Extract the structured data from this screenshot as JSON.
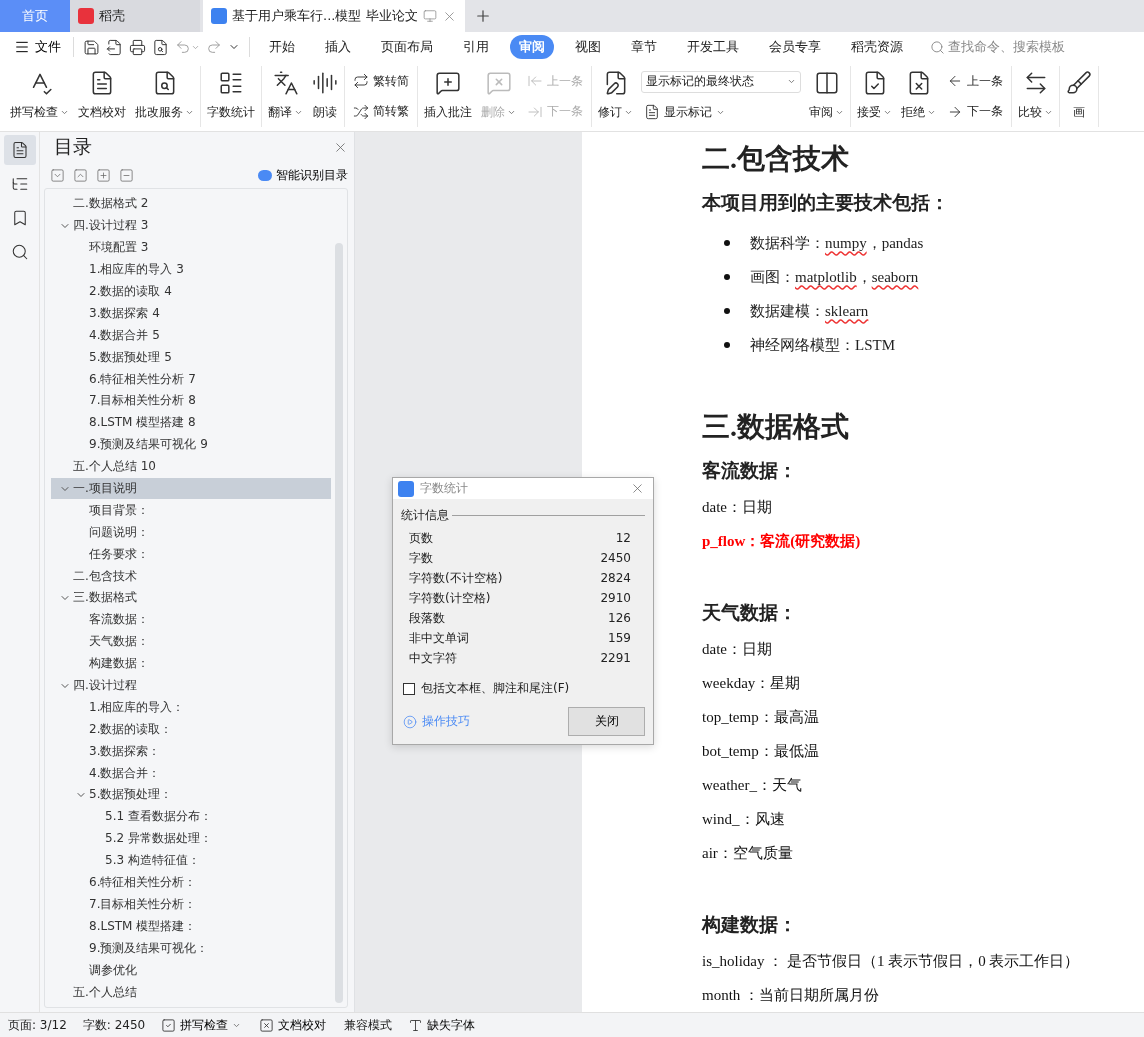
{
  "tabs": [
    {
      "label": "首页",
      "kind": "home",
      "selected": false
    },
    {
      "label": "稻壳",
      "kind": "app",
      "selected": false
    },
    {
      "label": "基于用户乘车行...模型 毕业论文",
      "kind": "document",
      "selected": true
    }
  ],
  "menu": {
    "file": "文件",
    "tabs": [
      {
        "label": "开始",
        "selected": false
      },
      {
        "label": "插入",
        "selected": false
      },
      {
        "label": "页面布局",
        "selected": false
      },
      {
        "label": "引用",
        "selected": false
      },
      {
        "label": "审阅",
        "selected": true
      },
      {
        "label": "视图",
        "selected": false
      },
      {
        "label": "章节",
        "selected": false
      },
      {
        "label": "开发工具",
        "selected": false
      },
      {
        "label": "会员专享",
        "selected": false
      },
      {
        "label": "稻壳资源",
        "selected": false
      }
    ],
    "search_placeholder": "查找命令、搜索模板"
  },
  "ribbon": {
    "groups": [
      {
        "items": [
          {
            "kind": "large",
            "label": "拼写检查",
            "menu": true,
            "disabled": false
          },
          {
            "kind": "large",
            "label": "文档校对",
            "menu": false,
            "disabled": false
          },
          {
            "kind": "large",
            "label": "批改服务",
            "menu": true,
            "disabled": false
          }
        ]
      },
      {
        "items": [
          {
            "kind": "large",
            "label": "字数统计",
            "menu": false,
            "disabled": false
          }
        ]
      },
      {
        "items": [
          {
            "kind": "large",
            "label": "翻译",
            "menu": true,
            "disabled": false
          },
          {
            "kind": "large",
            "label": "朗读",
            "menu": false,
            "disabled": false
          }
        ]
      },
      {
        "items": [
          {
            "kind": "stack",
            "items": [
              {
                "kind": "small",
                "label": "繁转简",
                "menu": false,
                "disabled": false
              },
              {
                "kind": "small",
                "label": "简转繁",
                "menu": false,
                "disabled": false
              }
            ]
          }
        ]
      },
      {
        "items": [
          {
            "kind": "large",
            "label": "插入批注",
            "menu": false,
            "disabled": false
          },
          {
            "kind": "large",
            "label": "删除",
            "menu": true,
            "disabled": true
          },
          {
            "kind": "stack",
            "items": [
              {
                "kind": "small",
                "label": "上一条",
                "menu": false,
                "disabled": true
              },
              {
                "kind": "small",
                "label": "下一条",
                "menu": false,
                "disabled": true
              }
            ]
          }
        ]
      },
      {
        "items": [
          {
            "kind": "large",
            "label": "修订",
            "menu": true,
            "disabled": false
          },
          {
            "kind": "stack",
            "items": [
              {
                "kind": "select",
                "value": "显示标记的最终状态"
              },
              {
                "kind": "small",
                "label": "显示标记",
                "menu": true,
                "disabled": false
              }
            ]
          },
          {
            "kind": "large",
            "label": "审阅",
            "menu": true,
            "disabled": false
          }
        ]
      },
      {
        "items": [
          {
            "kind": "large",
            "label": "接受",
            "menu": true,
            "disabled": false
          },
          {
            "kind": "large",
            "label": "拒绝",
            "menu": true,
            "disabled": false
          },
          {
            "kind": "stack",
            "items": [
              {
                "kind": "small",
                "label": "上一条",
                "menu": false,
                "disabled": false
              },
              {
                "kind": "small",
                "label": "下一条",
                "menu": false,
                "disabled": false
              }
            ]
          }
        ]
      },
      {
        "items": [
          {
            "kind": "large",
            "label": "比较",
            "menu": true,
            "disabled": false
          }
        ]
      },
      {
        "items": [
          {
            "kind": "large",
            "label": "画",
            "menu": false,
            "disabled": false
          }
        ]
      }
    ]
  },
  "rail": [
    {
      "selected": true
    },
    {
      "selected": false
    },
    {
      "selected": false
    },
    {
      "selected": false
    }
  ],
  "toc": {
    "title": "目录",
    "smart_button": "智能识别目录",
    "items": [
      {
        "label": "二.数据格式 2",
        "selected": false
      },
      {
        "label": "四.设计过程 3",
        "selected": false,
        "expanded": true,
        "children": [
          {
            "label": "环境配置 3",
            "selected": false
          },
          {
            "label": "1.相应库的导入 3",
            "selected": false
          },
          {
            "label": "2.数据的读取 4",
            "selected": false
          },
          {
            "label": "3.数据探索 4",
            "selected": false
          },
          {
            "label": "4.数据合并 5",
            "selected": false
          },
          {
            "label": "5.数据预处理 5",
            "selected": false
          },
          {
            "label": "6.特征相关性分析 7",
            "selected": false
          },
          {
            "label": "7.目标相关性分析 8",
            "selected": false
          },
          {
            "label": "8.LSTM 模型搭建 8",
            "selected": false
          },
          {
            "label": "9.预测及结果可视化 9",
            "selected": false
          }
        ]
      },
      {
        "label": "五.个人总结 10",
        "selected": false
      },
      {
        "label": "一.项目说明",
        "selected": true,
        "expanded": true,
        "children": [
          {
            "label": "项目背景：",
            "selected": false
          },
          {
            "label": "问题说明：",
            "selected": false
          },
          {
            "label": "任务要求：",
            "selected": false
          }
        ]
      },
      {
        "label": "二.包含技术",
        "selected": false
      },
      {
        "label": "三.数据格式",
        "selected": false,
        "expanded": true,
        "children": [
          {
            "label": "客流数据：",
            "selected": false
          },
          {
            "label": "天气数据：",
            "selected": false
          },
          {
            "label": "构建数据：",
            "selected": false
          }
        ]
      },
      {
        "label": "四.设计过程",
        "selected": false,
        "expanded": true,
        "children": [
          {
            "label": "1.相应库的导入：",
            "selected": false
          },
          {
            "label": "2.数据的读取：",
            "selected": false
          },
          {
            "label": "3.数据探索：",
            "selected": false
          },
          {
            "label": "4.数据合并：",
            "selected": false
          },
          {
            "label": "5.数据预处理：",
            "selected": false,
            "expanded": true,
            "children": [
              {
                "label": "5.1 查看数据分布：",
                "selected": false
              },
              {
                "label": "5.2 异常数据处理：",
                "selected": false
              },
              {
                "label": "5.3 构造特征值：",
                "selected": false
              }
            ]
          },
          {
            "label": "6.特征相关性分析：",
            "selected": false
          },
          {
            "label": "7.目标相关性分析：",
            "selected": false
          },
          {
            "label": "8.LSTM 模型搭建：",
            "selected": false
          },
          {
            "label": "9.预测及结果可视化：",
            "selected": false
          },
          {
            "label": "调参优化",
            "selected": false
          }
        ]
      },
      {
        "label": "五.个人总结",
        "selected": false
      }
    ]
  },
  "document": {
    "sections": [
      {
        "heading": "二.包含技术",
        "groups": [
          {
            "title": "本项目用到的主要技术包括：",
            "bullets": [
              [
                {
                  "text": "数据科学：",
                  "misspelled": false
                },
                {
                  "text": "numpy",
                  "misspelled": true
                },
                {
                  "text": "，pandas",
                  "misspelled": false
                }
              ],
              [
                {
                  "text": "画图：",
                  "misspelled": false
                },
                {
                  "text": "matplotlib",
                  "misspelled": true
                },
                {
                  "text": "，",
                  "misspelled": false
                },
                {
                  "text": "seaborn",
                  "misspelled": true
                }
              ],
              [
                {
                  "text": "数据建模：",
                  "misspelled": false
                },
                {
                  "text": "sklearn",
                  "misspelled": true
                }
              ],
              [
                {
                  "text": "神经网络模型：LSTM",
                  "misspelled": false
                }
              ]
            ]
          }
        ]
      },
      {
        "heading": "三.数据格式",
        "groups": [
          {
            "title": "客流数据：",
            "lines": [
              {
                "text": "date：日期",
                "emphasis": false
              },
              {
                "text": "p_flow：客流(研究数据)",
                "emphasis": true
              }
            ]
          },
          {
            "title": "天气数据：",
            "lines": [
              {
                "text": "date：日期",
                "emphasis": false
              },
              {
                "text": "weekday：星期",
                "emphasis": false
              },
              {
                "text": "top_temp：最高温",
                "emphasis": false
              },
              {
                "text": "bot_temp：最低温",
                "emphasis": false
              },
              {
                "text": "weather_：天气",
                "emphasis": false
              },
              {
                "text": "wind_：风速",
                "emphasis": false
              },
              {
                "text": "air：空气质量",
                "emphasis": false
              }
            ]
          },
          {
            "title": "构建数据：",
            "lines": [
              {
                "text": "is_holiday ：  是否节假日（1 表示节假日，0 表示工作日）",
                "emphasis": false
              },
              {
                "text": "month ：当前日期所属月份",
                "emphasis": false
              }
            ]
          }
        ]
      }
    ]
  },
  "dialog": {
    "title": "字数统计",
    "group": "统计信息",
    "rows": [
      {
        "label": "页数",
        "value": "12"
      },
      {
        "label": "字数",
        "value": "2450"
      },
      {
        "label": "字符数(不计空格)",
        "value": "2824"
      },
      {
        "label": "字符数(计空格)",
        "value": "2910"
      },
      {
        "label": "段落数",
        "value": "126"
      },
      {
        "label": "非中文单词",
        "value": "159"
      },
      {
        "label": "中文字符",
        "value": "2291"
      }
    ],
    "checkbox": {
      "label": "包括文本框、脚注和尾注(F)",
      "checked": false
    },
    "tips_link": "操作技巧",
    "close_button": "关闭"
  },
  "status_bar": [
    {
      "kind": "text",
      "label": "页面: 3/12"
    },
    {
      "kind": "text",
      "label": "字数: 2450"
    },
    {
      "kind": "button",
      "label": "拼写检查",
      "menu": true
    },
    {
      "kind": "button",
      "label": "文档校对",
      "menu": false
    },
    {
      "kind": "text",
      "label": "兼容模式"
    },
    {
      "kind": "button",
      "label": "缺失字体",
      "menu": false
    }
  ]
}
